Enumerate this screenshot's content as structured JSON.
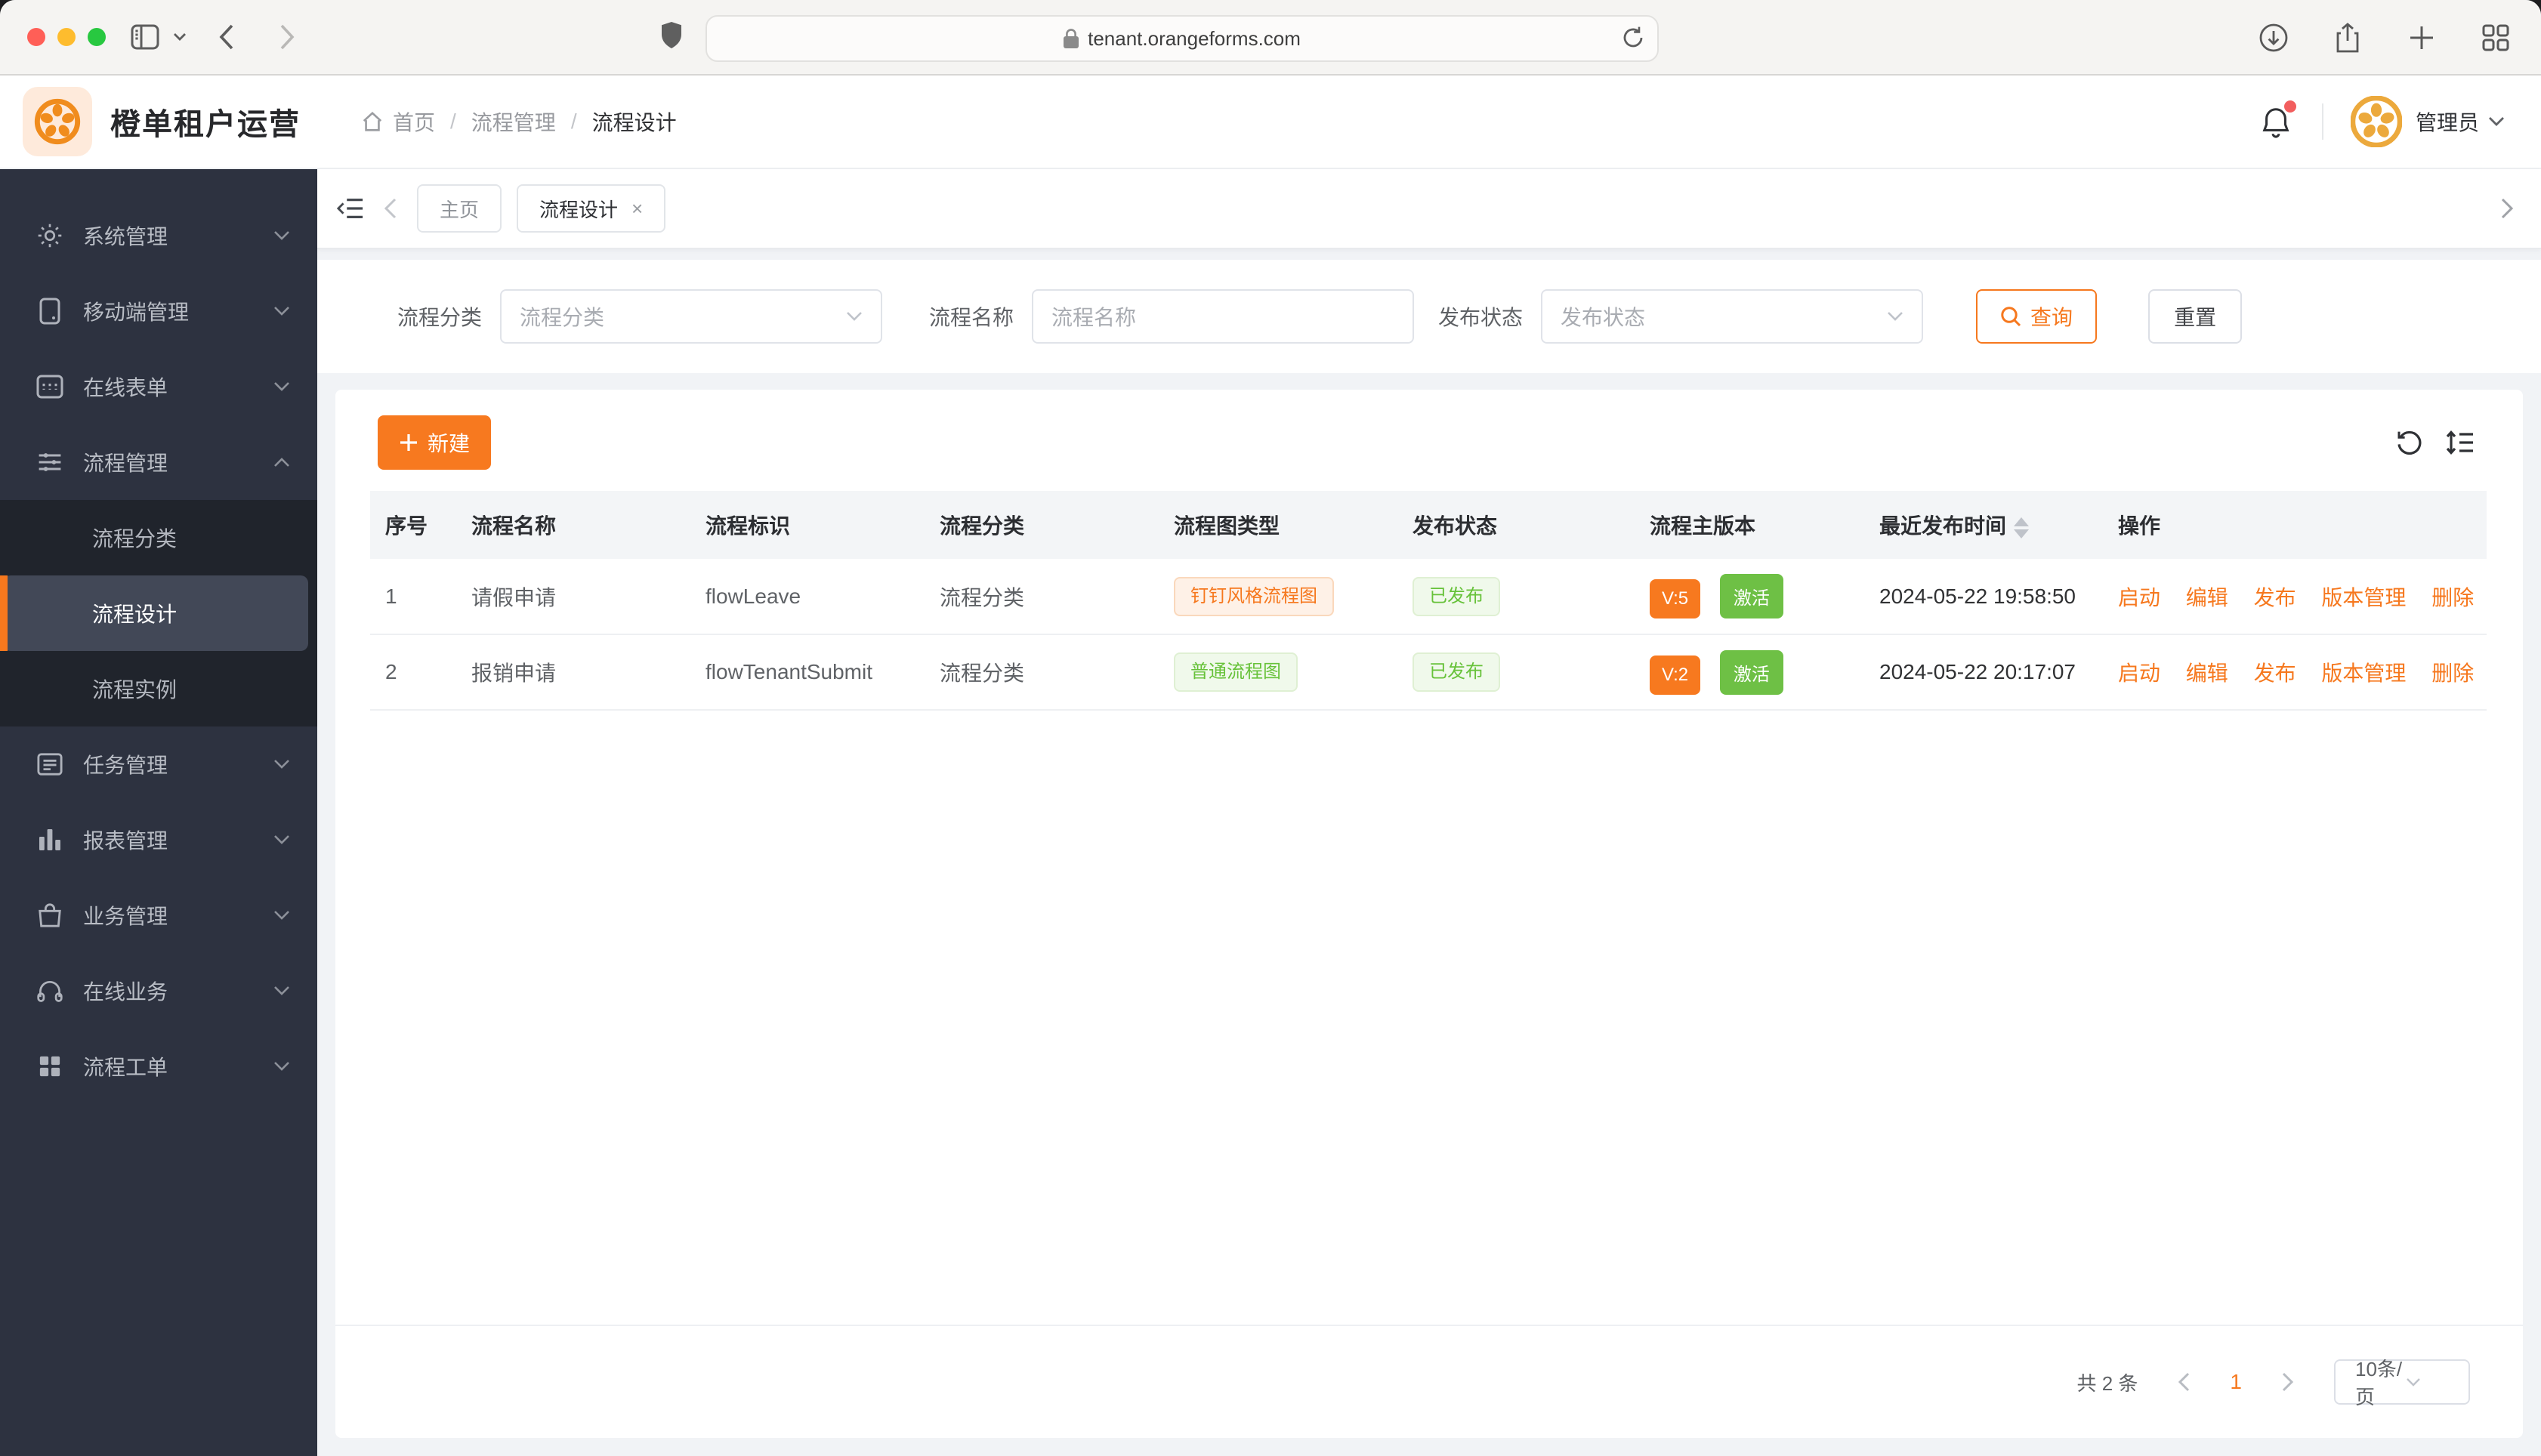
{
  "browser": {
    "url": "tenant.orangeforms.com"
  },
  "header": {
    "app_title": "橙单租户运营",
    "breadcrumb": [
      "首页",
      "流程管理",
      "流程设计"
    ],
    "user_name": "管理员"
  },
  "sidebar": {
    "items": [
      {
        "label": "系统管理"
      },
      {
        "label": "移动端管理"
      },
      {
        "label": "在线表单"
      },
      {
        "label": "流程管理",
        "children": [
          "流程分类",
          "流程设计",
          "流程实例"
        ],
        "active_child": "流程设计"
      },
      {
        "label": "任务管理"
      },
      {
        "label": "报表管理"
      },
      {
        "label": "业务管理"
      },
      {
        "label": "在线业务"
      },
      {
        "label": "流程工单"
      }
    ]
  },
  "tabs": {
    "home_label": "主页",
    "active_label": "流程设计",
    "close_glyph": "×"
  },
  "filters": {
    "category_label": "流程分类",
    "category_placeholder": "流程分类",
    "name_label": "流程名称",
    "name_placeholder": "流程名称",
    "status_label": "发布状态",
    "status_placeholder": "发布状态",
    "query_label": "查询",
    "reset_label": "重置"
  },
  "toolbar": {
    "create_label": "新建"
  },
  "table": {
    "columns": [
      "序号",
      "流程名称",
      "流程标识",
      "流程分类",
      "流程图类型",
      "发布状态",
      "流程主版本",
      "最近发布时间",
      "操作"
    ],
    "rows": [
      {
        "index": "1",
        "name": "请假申请",
        "key": "flowLeave",
        "category": "流程分类",
        "diagram_type": "钉钉风格流程图",
        "publish_status": "已发布",
        "version": "V:5",
        "active_state": "激活",
        "published_at": "2024-05-22 19:58:50"
      },
      {
        "index": "2",
        "name": "报销申请",
        "key": "flowTenantSubmit",
        "category": "流程分类",
        "diagram_type": "普通流程图",
        "publish_status": "已发布",
        "version": "V:2",
        "active_state": "激活",
        "published_at": "2024-05-22 20:17:07"
      }
    ],
    "row_actions": [
      "启动",
      "编辑",
      "发布",
      "版本管理",
      "删除"
    ]
  },
  "pagination": {
    "total_label": "共 2 条",
    "current_page": "1",
    "page_size_label": "10条/页"
  },
  "colors": {
    "accent_orange": "#F6781E",
    "solid_orange": "#F7791F",
    "success_green": "#67C23A",
    "solid_green": "#6EC045",
    "sidebar_bg": "#2D3240",
    "sidebar_submenu_bg": "#20242C"
  }
}
